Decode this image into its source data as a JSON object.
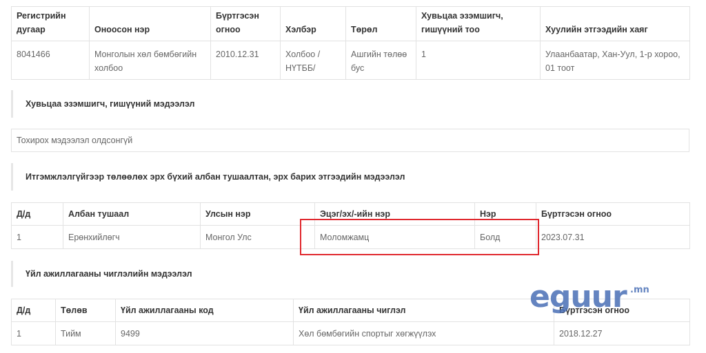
{
  "org_table": {
    "headers": [
      "Регистрийн дугаар",
      "Оноосон нэр",
      "Бүртгэсэн огноо",
      "Хэлбэр",
      "Төрөл",
      "Хувьцаа эзэмшигч, гишүүний тоо",
      "Хуулийн этгээдийн хаяг"
    ],
    "row": [
      "8041466",
      "Монголын хөл бөмбөгийн холбоо",
      "2010.12.31",
      "Холбоо / НҮТББ/",
      "Ашгийн төлөө бус",
      "1",
      "Улаанбаатар, Хан-Уул, 1-р хороо, 01 тоот"
    ]
  },
  "shareholders": {
    "title": "Хувьцаа эзэмшигч, гишүүний мэдээлэл",
    "empty_text": "Тохирох мэдээлэл олдсонгүй"
  },
  "officials": {
    "title": "Итгэмжлэлгүйгээр төлөөлөх эрх бүхий албан тушаалтан, эрх барих этгээдийн мэдээлэл",
    "headers": [
      "Д/д",
      "Албан тушаал",
      "Улсын нэр",
      "Эцэг/эх/-ийн нэр",
      "Нэр",
      "Бүртгэсэн огноо"
    ],
    "row": [
      "1",
      "Ерөнхийлөгч",
      "Монгол Улс",
      "Моломжамц",
      "Болд",
      "2023.07.31"
    ]
  },
  "activities": {
    "title": "Үйл ажиллагааны чиглэлийн мэдээлэл",
    "headers": [
      "Д/д",
      "Төлөв",
      "Үйл ажиллагааны код",
      "Үйл ажиллагааны чиглэл",
      "Бүртгэсэн огноо"
    ],
    "row": [
      "1",
      "Тийм",
      "9499",
      "Хөл бөмбөгийн спортыг хөгжүүлэх",
      "2018.12.27"
    ]
  },
  "watermark": {
    "text": "eguur",
    "suffix": ".mn"
  },
  "colors": {
    "highlight": "#e0282e",
    "watermark": "#4a6fb6"
  }
}
